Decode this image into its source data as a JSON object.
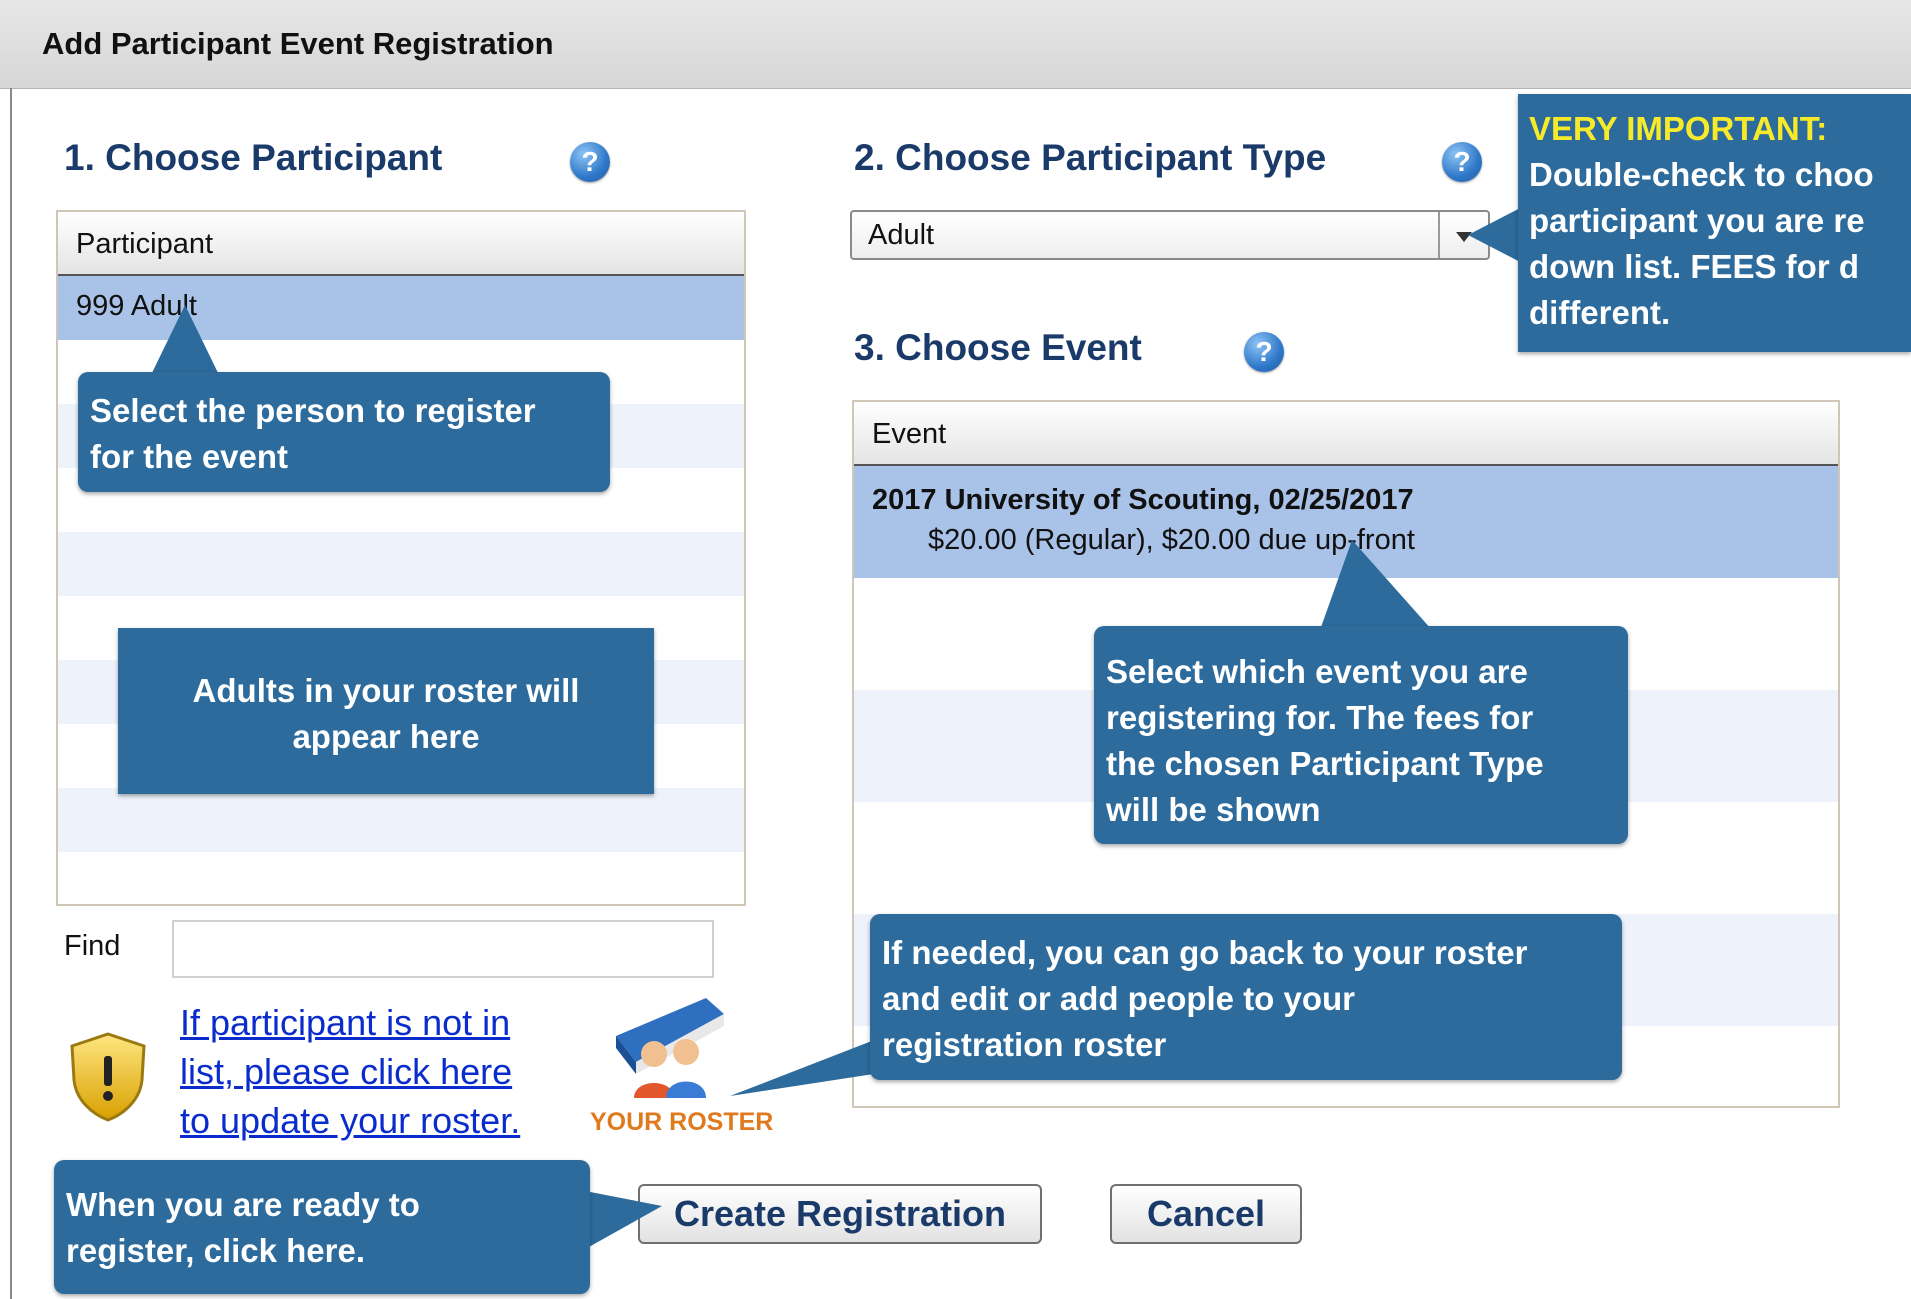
{
  "window": {
    "title": "Add Participant Event Registration"
  },
  "participant_section": {
    "title": "1. Choose Participant",
    "help_glyph": "?",
    "column_header": "Participant",
    "rows": [
      "999 Adult"
    ]
  },
  "participant_type_section": {
    "title": "2. Choose Participant Type",
    "help_glyph": "?",
    "selected_value": "Adult"
  },
  "event_section": {
    "title": "3. Choose Event",
    "help_glyph": "?",
    "column_header": "Event",
    "events": [
      {
        "name": "2017 University of Scouting, 02/25/2017",
        "fees": "$20.00 (Regular), $20.00 due up-front"
      }
    ]
  },
  "find": {
    "label": "Find",
    "value": ""
  },
  "roster_link": {
    "line1": "If participant is not in",
    "line2": "list, please click here",
    "line3": "to update your roster.",
    "icon_caption": "YOUR ROSTER"
  },
  "buttons": {
    "create": "Create Registration",
    "cancel": "Cancel"
  },
  "callouts": {
    "very_important_title": "VERY IMPORTANT:",
    "very_important_lines": [
      "Double-check to choo",
      "participant you are re",
      "down list.  FEES for d",
      "different."
    ],
    "select_person": [
      "Select the person to register",
      "for the event"
    ],
    "adults_roster": [
      "Adults in your roster will",
      "appear here"
    ],
    "select_event": [
      "Select which event you are",
      "registering for.  The fees for",
      "the chosen Participant Type",
      "will be shown"
    ],
    "go_back": [
      "If needed, you can go back to your roster",
      "and edit or add people to your",
      "registration roster"
    ],
    "ready": [
      "When you are ready to",
      "register, click here."
    ]
  },
  "colors": {
    "callout_bg": "#2c6b9c",
    "callout_highlight": "#f6ea2a",
    "selected_row": "#a8c2e8",
    "section_title": "#1a3a6a",
    "link": "#0a2ccc"
  }
}
